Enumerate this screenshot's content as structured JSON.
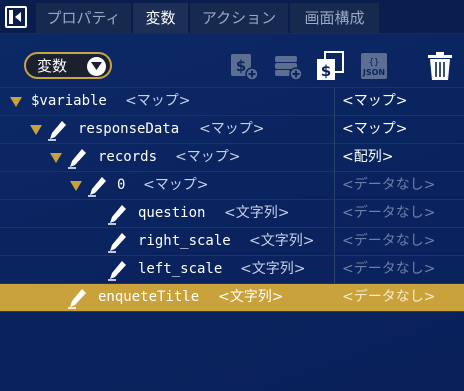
{
  "tabs": [
    {
      "label": "プロパティ",
      "active": false
    },
    {
      "label": "変数",
      "active": true
    },
    {
      "label": "アクション",
      "active": false
    },
    {
      "label": "画面構成",
      "active": false
    }
  ],
  "toolbar": {
    "filter_value": "変数",
    "icons": [
      "add-variable-icon",
      "add-list-icon",
      "copy-variable-icon",
      "json-icon",
      "delete-icon"
    ]
  },
  "tree": [
    {
      "key": "$variable",
      "type": "<マップ>",
      "value": "<マップ>",
      "has_toggle": true,
      "has_pencil": false,
      "value_style": "bright"
    },
    {
      "key": "responseData",
      "type": "<マップ>",
      "value": "<マップ>",
      "has_toggle": true,
      "has_pencil": true,
      "value_style": "bright"
    },
    {
      "key": "records",
      "type": "<マップ>",
      "value": "<配列>",
      "has_toggle": true,
      "has_pencil": true,
      "value_style": "bright"
    },
    {
      "key": "0",
      "type": "<マップ>",
      "value": "<データなし>",
      "has_toggle": true,
      "has_pencil": true,
      "value_style": "dim"
    },
    {
      "key": "question",
      "type": "<文字列>",
      "value": "<データなし>",
      "has_toggle": false,
      "has_pencil": true,
      "value_style": "dim"
    },
    {
      "key": "right_scale",
      "type": "<文字列>",
      "value": "<データなし>",
      "has_toggle": false,
      "has_pencil": true,
      "value_style": "dim"
    },
    {
      "key": "left_scale",
      "type": "<文字列>",
      "value": "<データなし>",
      "has_toggle": false,
      "has_pencil": true,
      "value_style": "dim"
    },
    {
      "key": "enqueteTitle",
      "type": "<文字列>",
      "value": "<データなし>",
      "has_toggle": false,
      "has_pencil": true,
      "value_style": "dim",
      "selected": true
    }
  ],
  "colors": {
    "background": "#0a2460",
    "accent": "#c9a23b",
    "dim_text": "#6c7fa6"
  }
}
